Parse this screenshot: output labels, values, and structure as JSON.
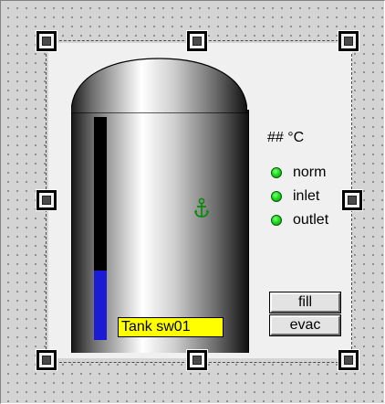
{
  "tank": {
    "label": "Tank  sw01",
    "level_fraction": 0.31
  },
  "readout": {
    "temperature": "## °C"
  },
  "status": [
    {
      "label": "norm",
      "color": "#1fdc1f"
    },
    {
      "label": "inlet",
      "color": "#1fdc1f"
    },
    {
      "label": "outlet",
      "color": "#1fdc1f"
    }
  ],
  "buttons": {
    "fill": "fill",
    "evac": "evac"
  },
  "icons": {
    "anchor": "anchor-icon",
    "resize_handle": "resize-handle-icon"
  },
  "colors": {
    "canvas": "#d4d4d4",
    "panel": "#f0f0f0",
    "level_fill": "#1b1bd6",
    "label_bg": "#ffff00",
    "led": "#1fdc1f",
    "anchor": "#0a8a0a"
  }
}
